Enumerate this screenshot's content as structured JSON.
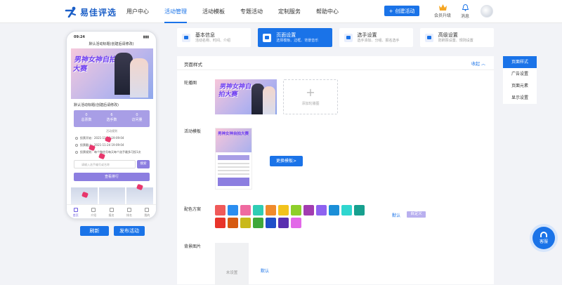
{
  "app": {
    "name": "易佳评选"
  },
  "nav": {
    "items": [
      "用户中心",
      "活动管理",
      "活动模板",
      "专题活动",
      "定制服务",
      "帮助中心"
    ],
    "active_index": 1
  },
  "header": {
    "create_label": "创建活动",
    "vip_label": "会员升级",
    "message_label": "消息"
  },
  "phone": {
    "time": "09:24",
    "title": "默认活动标题(创建后请修改)",
    "banner_text": "男神女神自拍大赛",
    "activity_name": "默认活动标题(创建后请修改)",
    "stats": [
      {
        "value": "0",
        "label": "总票数"
      },
      {
        "value": "6",
        "label": "选手数"
      },
      {
        "value": "0",
        "label": "访问量"
      }
    ],
    "rules_label": "活动规则",
    "lines": [
      "投票开始：2021-11-18 19:09:04",
      "投票截止：2021-11-24 19:09:04",
      "投票规则：每个微信号每天每个选手最多可投1次"
    ],
    "search_placeholder": "请输入选手编号或名称",
    "search_btn": "搜索",
    "rank_btn": "查看排行",
    "tabs": [
      "首页",
      "介绍",
      "报名",
      "排名",
      "我的"
    ]
  },
  "actions": {
    "refresh": "刷新",
    "publish": "发布活动"
  },
  "steps": [
    {
      "title": "基本信息",
      "sub": "活动名称、时间、介绍"
    },
    {
      "title": "页面设置",
      "sub": "选择模板、边框、背景音乐"
    },
    {
      "title": "选手设置",
      "sub": "选手添加、分组、报名选手"
    },
    {
      "title": "高级设置",
      "sub": "防刷票设置、规则设置"
    }
  ],
  "panel": {
    "title": "页面样式",
    "collapse": "收起",
    "carousel_label": "轮播图",
    "carousel_banner_text": "男神女神自拍大赛",
    "add_carousel": "添加轮播图",
    "template_label": "活动模板",
    "template_banner_text": "男神女神自拍大赛",
    "change_template": "更换模板>",
    "color_label": "配色方案",
    "color_default": "默认",
    "color_custom": "自定义",
    "bg_label": "背景图片",
    "bg_unset": "未设置",
    "bg_default": "默认"
  },
  "colors": [
    "#f05a5a",
    "#2b8ef0",
    "#ef6aa0",
    "#2fcdb4",
    "#f08a2c",
    "#f2c31c",
    "#8ecf2a",
    "#a23cb0",
    "#8e62f0",
    "#1b8fd8",
    "#2fd6cf",
    "#17a08f",
    "#e8342a",
    "#d65a12",
    "#c9b91a",
    "#3fa83a",
    "#1f4fc8",
    "#5a2fb0",
    "#e268e8"
  ],
  "right_nav": [
    "页面样式",
    "广告设置",
    "页面元素",
    "显示设置"
  ],
  "service_label": "客服"
}
